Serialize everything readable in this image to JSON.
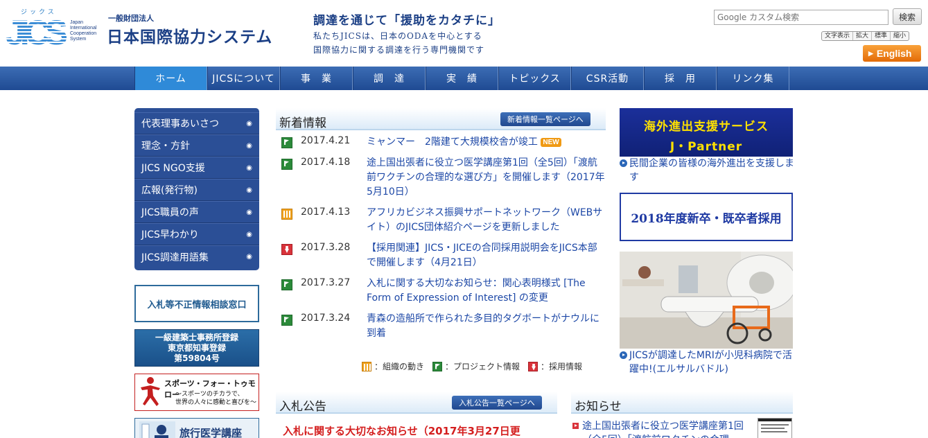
{
  "header": {
    "logo_kana": "ジックス",
    "logo_letters": "JICS",
    "logo_en": [
      "Japan",
      "International",
      "Cooperation",
      "System"
    ],
    "org_prefix": "一般財団法人",
    "org_name": "日本国際協力システム",
    "tagline_1": "調達を通じて「援助をカタチに」",
    "tagline_2": "私たちJICSは、日本のODAを中心とする",
    "tagline_3": "国際協力に関する調達を行う専門機関です",
    "search_placeholder": "Google カスタム検索",
    "search_button": "検索",
    "text_size": [
      "文字表示",
      "拡大",
      "標準",
      "縮小"
    ],
    "english_button": "English"
  },
  "nav": [
    "ホーム",
    "JICSについて",
    "事　業",
    "調　達",
    "実　績",
    "トピックス",
    "CSR活動",
    "採　用",
    "リンク集"
  ],
  "sidebar": {
    "items": [
      "代表理事あいさつ",
      "理念・方針",
      "JICS NGO支援",
      "広報(発行物)",
      "JICS職員の声",
      "JICS早わかり",
      "JICS調達用語集"
    ],
    "banner_fraud": "入札等不正情報相談窓口",
    "banner_arch": [
      "一級建築士事務所登録",
      "東京都知事登録",
      "第59804号"
    ],
    "banner_sports_1": "スポーツ・フォー・トゥモロー",
    "banner_sports_2": "〜スポーツのチカラで、",
    "banner_sports_3": "世界の人々に感動と喜びを〜",
    "banner_travel": "旅行医学講座"
  },
  "news": {
    "title": "新着情報",
    "more": "新着情報一覧ページへ",
    "new_badge": "NEW",
    "items": [
      {
        "type": "project",
        "date": "2017.4.21",
        "text": "ミャンマー　2階建て大規模校舎が竣工"
      },
      {
        "type": "project",
        "date": "2017.4.18",
        "text": "途上国出張者に役立つ医学講座第1回（全5回）「渡航前ワクチンの合理的な選び方」を開催します（2017年5月10日）"
      },
      {
        "type": "org",
        "date": "2017.4.13",
        "text": "アフリカビジネス振興サポートネットワーク（WEBサイト）のJICS団体紹介ページを更新しました"
      },
      {
        "type": "recruit",
        "date": "2017.3.28",
        "text": "【採用関連】JICS・JICEの合同採用説明会をJICS本部で開催します（4月21日）"
      },
      {
        "type": "project",
        "date": "2017.3.27",
        "text": "入札に関する大切なお知らせ：関心表明様式 [The Form of Expression of Interest] の変更"
      },
      {
        "type": "project",
        "date": "2017.3.24",
        "text": "青森の造船所で作られた多目的タグボートがナウルに到着"
      }
    ],
    "legend": [
      "：組織の動き",
      "：プロジェクト情報",
      "：採用情報"
    ]
  },
  "bid": {
    "title": "入札公告",
    "more": "入札公告一覧ページへ",
    "alert": "入札に関する大切なお知らせ（2017年3月27日更"
  },
  "notice": {
    "title": "お知らせ",
    "item": "途上国出張者に役立つ医学講座第1回（全5回）「渡航前ワクチンの合理"
  },
  "right": {
    "jpartner_1": "海外進出支援サービス",
    "jpartner_2": "J・Partner",
    "jpartner_link": "民間企業の皆様の海外進出を支援します",
    "recruit": "2018年度新卒・既卒者採用",
    "photo_link": "JICSが調達したMRIが小児科病院で活躍中!(エルサルバドル)"
  },
  "colors": {
    "nav": "#2b57a0",
    "nav_active": "#2f8ad8",
    "link": "#1c47a6",
    "brand": "#1b3f85",
    "english": "#f08a1c",
    "jpartner_bg": "#1b2f9a",
    "jpartner_text": "#ffe100"
  }
}
